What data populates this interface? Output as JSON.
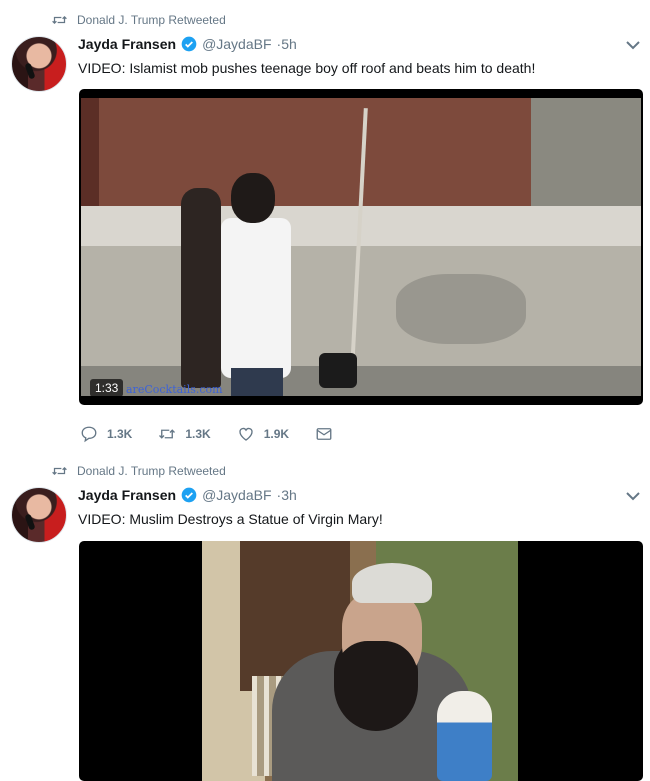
{
  "tweets": [
    {
      "retweet_context": "Donald J. Trump Retweeted",
      "name": "Jayda Fransen",
      "handle": "@JaydaBF",
      "time": "·5h",
      "text": "VIDEO: Islamist mob pushes teenage boy off roof and beats him to death!",
      "media": {
        "duration": "1:33",
        "watermark": "areCocktails.com"
      },
      "actions": {
        "replies": "1.3K",
        "retweets": "1.3K",
        "likes": "1.9K"
      }
    },
    {
      "retweet_context": "Donald J. Trump Retweeted",
      "name": "Jayda Fransen",
      "handle": "@JaydaBF",
      "time": "·3h",
      "text": "VIDEO: Muslim Destroys a Statue of Virgin Mary!"
    }
  ],
  "icons": {
    "retweet_context": "retweet-icon",
    "verified": "verified-badge-icon",
    "menu": "chevron-down-icon",
    "reply": "reply-icon",
    "retweet": "retweet-icon",
    "like": "heart-icon",
    "dm": "envelope-icon"
  },
  "colors": {
    "secondary_text": "#657786",
    "verified_blue": "#1da1f2",
    "divider": "#e6ecf0"
  }
}
